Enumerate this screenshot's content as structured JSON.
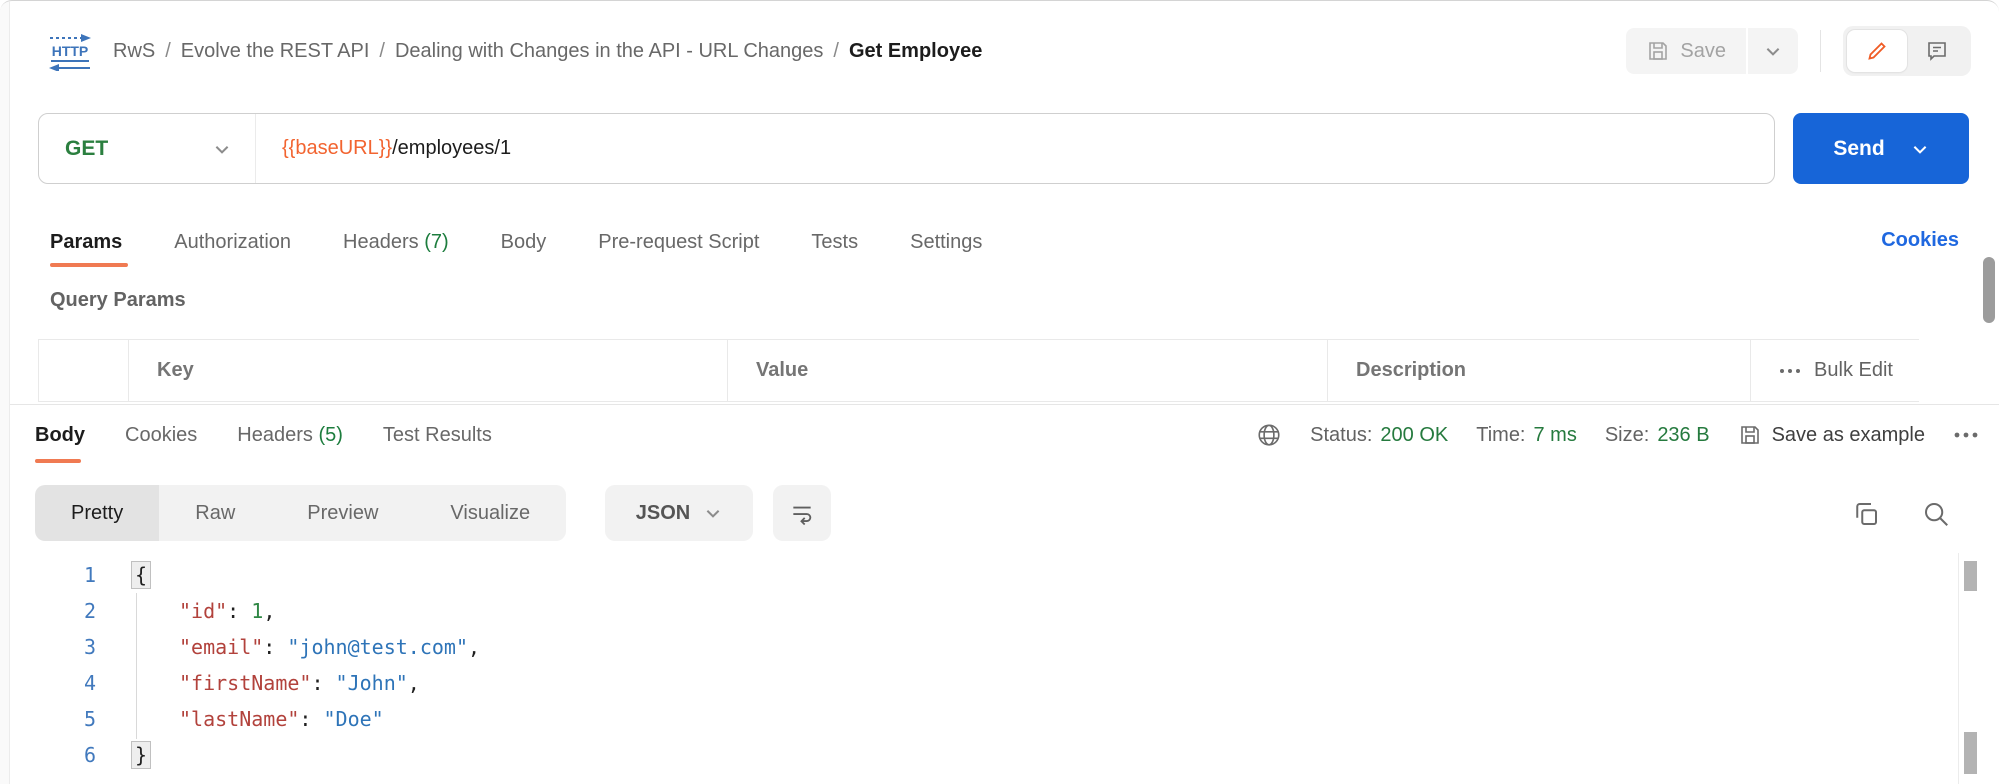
{
  "breadcrumb": {
    "protocol": "HTTP",
    "workspace": "RwS",
    "separator": "/",
    "items": [
      "Evolve the REST API",
      "Dealing with Changes in the API - URL Changes"
    ],
    "current": "Get Employee"
  },
  "top_actions": {
    "save_label": "Save"
  },
  "request": {
    "method": "GET",
    "url_variable": "{{baseURL}}",
    "url_path": "/employees/1",
    "send_label": "Send"
  },
  "request_tabs": {
    "params": "Params",
    "authorization": "Authorization",
    "headers_label": "Headers",
    "headers_count": "(7)",
    "body": "Body",
    "pre_request": "Pre-request Script",
    "tests": "Tests",
    "settings": "Settings",
    "active": "Params",
    "cookies_link": "Cookies"
  },
  "query_params": {
    "title": "Query Params",
    "columns": [
      "Key",
      "Value",
      "Description"
    ],
    "bulk_edit": "Bulk Edit"
  },
  "response": {
    "tab_body": "Body",
    "tab_cookies": "Cookies",
    "headers_label": "Headers",
    "headers_count": "(5)",
    "tab_test_results": "Test Results",
    "active_tab": "Body",
    "status_label": "Status:",
    "status_value": "200 OK",
    "time_label": "Time:",
    "time_value": "7 ms",
    "size_label": "Size:",
    "size_value": "236 B",
    "save_as_example": "Save as example",
    "view_pretty": "Pretty",
    "view_raw": "Raw",
    "view_preview": "Preview",
    "view_visualize": "Visualize",
    "active_view": "Pretty",
    "format": "JSON"
  },
  "body_json": {
    "line_numbers": [
      "1",
      "2",
      "3",
      "4",
      "5",
      "6"
    ],
    "line1": {
      "open_brace": "{"
    },
    "line2": {
      "key": "\"id\"",
      "colon": ": ",
      "value": "1",
      "comma": ","
    },
    "line3": {
      "key": "\"email\"",
      "colon": ": ",
      "value": "\"john@test.com\"",
      "comma": ","
    },
    "line4": {
      "key": "\"firstName\"",
      "colon": ": ",
      "value": "\"John\"",
      "comma": ","
    },
    "line5": {
      "key": "\"lastName\"",
      "colon": ": ",
      "value": "\"Doe\""
    },
    "line6": {
      "close_brace": "}"
    }
  },
  "colors": {
    "accent_orange": "#f07a52",
    "variable_orange": "#f26430",
    "method_green": "#2b7f3f",
    "status_green": "#257a3e",
    "send_blue": "#1765d8",
    "link_blue": "#1f68e0",
    "json_key": "#b2423c",
    "json_string": "#2e74b8",
    "json_number": "#2f8744",
    "line_number_blue": "#4179bd"
  }
}
